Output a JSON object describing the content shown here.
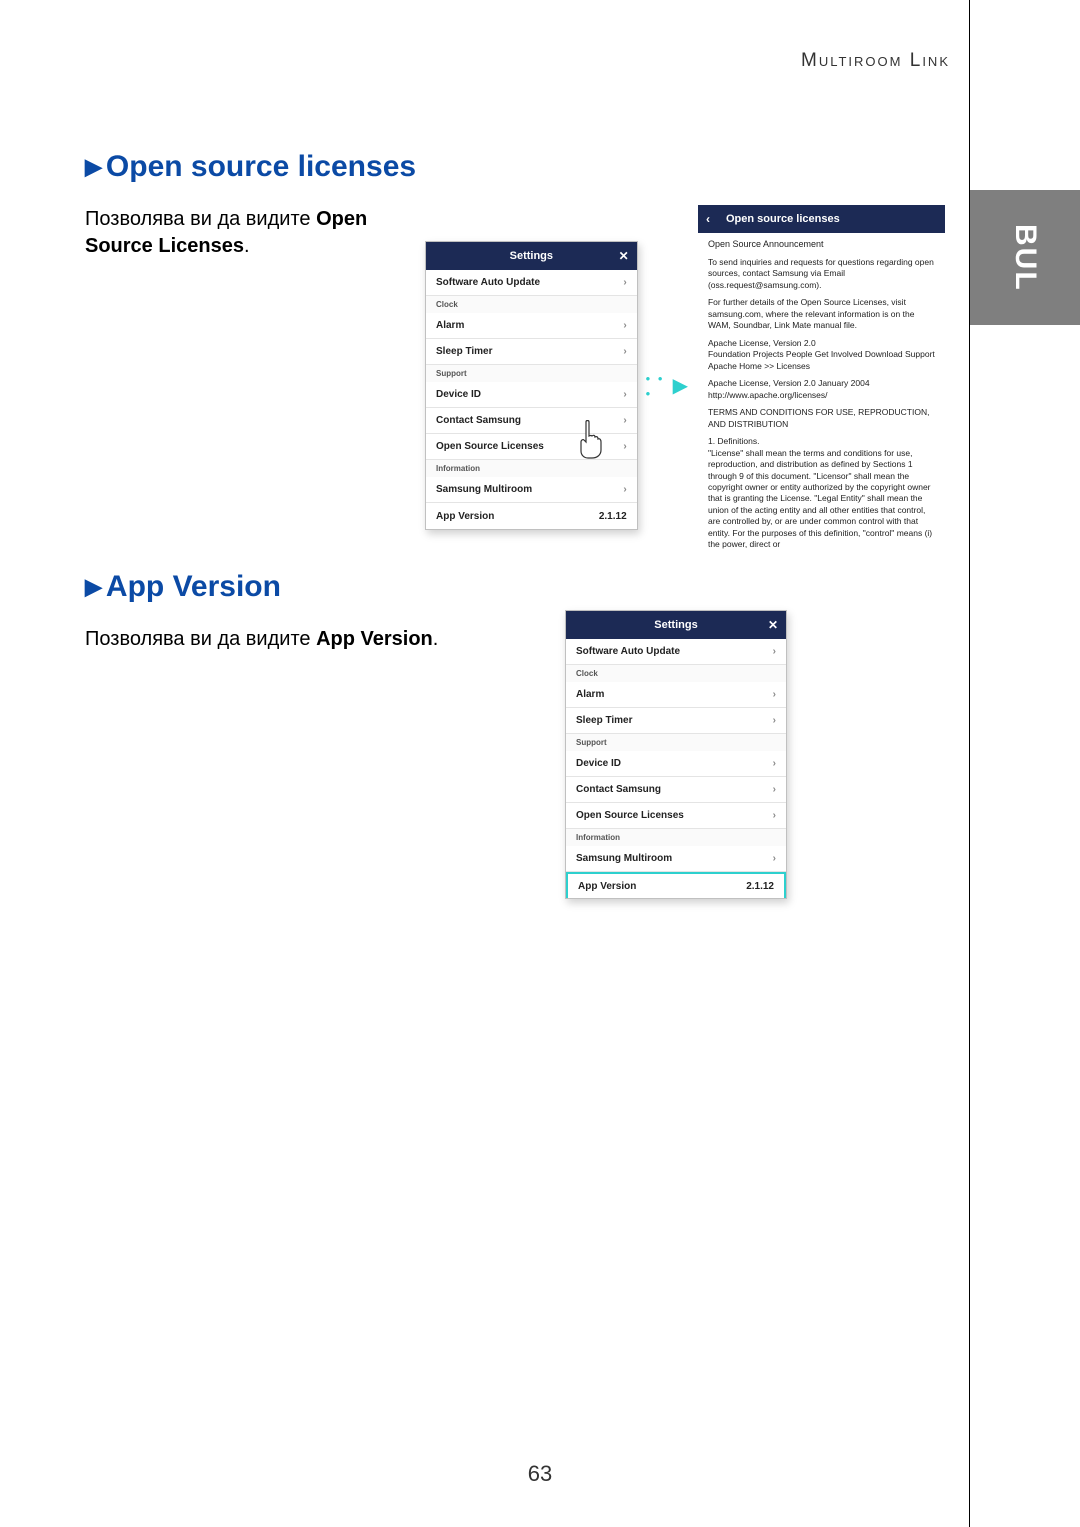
{
  "header": {
    "label": "Multiroom Link"
  },
  "sideTab": "BUL",
  "pageNumber": "63",
  "section1": {
    "heading": "Open source licenses",
    "body_prefix": "Позволява ви да видите ",
    "body_bold": "Open Source Licenses",
    "body_suffix": "."
  },
  "section2": {
    "heading": "App Version",
    "body_prefix": "Позволява ви да видите ",
    "body_bold": "App Version",
    "body_suffix": "."
  },
  "settingsPanel": {
    "title": "Settings",
    "rows": {
      "softwareAutoUpdate": "Software Auto Update",
      "groupClock": "Clock",
      "alarm": "Alarm",
      "sleepTimer": "Sleep Timer",
      "groupSupport": "Support",
      "deviceId": "Device ID",
      "contactSamsung": "Contact Samsung",
      "openSourceLicenses": "Open Source Licenses",
      "groupInformation": "Information",
      "samsungMultiroom": "Samsung Multiroom",
      "appVersion": "App Version",
      "appVersionValue": "2.1.12"
    }
  },
  "licensePanel": {
    "title": "Open source licenses",
    "subtitle": "Open Source Announcement",
    "p1": "To send inquiries and requests for questions regarding open sources, contact Samsung via Email (oss.request@samsung.com).",
    "p2": "For further details of the Open Source Licenses, visit samsung.com, where the relevant information is on the WAM, Soundbar, Link Mate manual file.",
    "p3": "Apache License, Version 2.0\nFoundation Projects People Get Involved Download Support Apache Home >> Licenses",
    "p4": "Apache License, Version 2.0 January 2004\nhttp://www.apache.org/licenses/",
    "p5": "TERMS AND CONDITIONS FOR USE, REPRODUCTION, AND DISTRIBUTION",
    "p6": "1. Definitions.\n\"License\" shall mean the terms and conditions for use, reproduction, and distribution as defined by Sections 1 through 9 of this document. \"Licensor\" shall mean the copyright owner or entity authorized by the copyright owner that is granting the License. \"Legal Entity\" shall mean the union of the acting entity and all other entities that control, are controlled by, or are under common control with that entity. For the purposes of this definition, \"control\" means (i) the power, direct or"
  }
}
